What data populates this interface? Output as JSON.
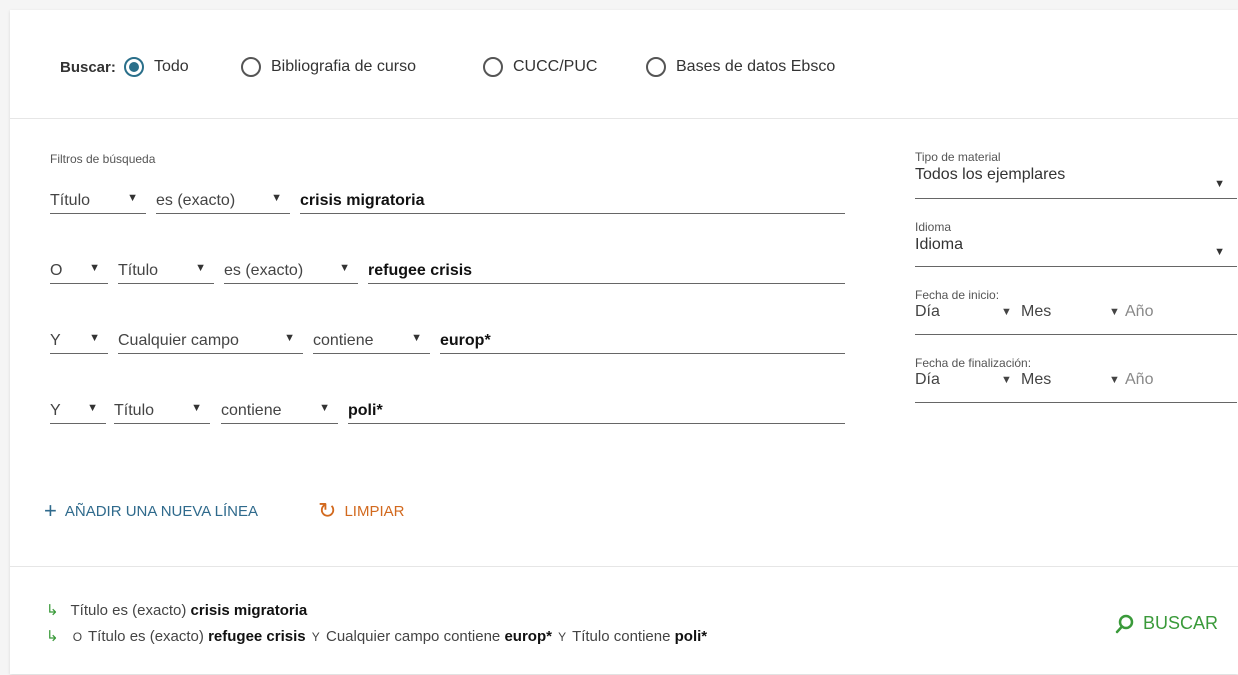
{
  "scope": {
    "label": "Buscar:",
    "options": [
      {
        "label": "Todo",
        "checked": true
      },
      {
        "label": "Bibliografia de curso",
        "checked": false
      },
      {
        "label": "CUCC/PUC",
        "checked": false
      },
      {
        "label": "Bases de datos Ebsco",
        "checked": false
      }
    ]
  },
  "filters": {
    "title": "Filtros de búsqueda",
    "rows": [
      {
        "field": "Título",
        "operator": "es (exacto)",
        "value": "crisis migratoria"
      },
      {
        "boolean": "O",
        "field": "Título",
        "operator": "es (exacto)",
        "value": "refugee crisis"
      },
      {
        "boolean": "Y",
        "field": "Cualquier campo",
        "operator": "contiene",
        "value": "europ*"
      },
      {
        "boolean": "Y",
        "field": "Título",
        "operator": "contiene",
        "value": "poli*"
      }
    ]
  },
  "side": {
    "material": {
      "label": "Tipo de material",
      "value": "Todos los ejemplares"
    },
    "language": {
      "label": "Idioma",
      "value": "Idioma"
    },
    "start_date": {
      "label": "Fecha de inicio:",
      "day": "Día",
      "month": "Mes",
      "year": "Año"
    },
    "end_date": {
      "label": "Fecha de finalización:",
      "day": "Día",
      "month": "Mes",
      "year": "Año"
    }
  },
  "actions": {
    "add_line": "AÑADIR UNA NUEVA LÍNEA",
    "clear": "LIMPIAR"
  },
  "summary": {
    "line1": {
      "field": "Título",
      "operator": "es (exacto)",
      "value": "crisis migratoria"
    },
    "line2": [
      {
        "boolean": "O",
        "field": "Título",
        "operator": "es (exacto)",
        "value": "refugee crisis"
      },
      {
        "boolean": "Y",
        "field": "Cualquier campo",
        "operator": "contiene",
        "value": "europ*"
      },
      {
        "boolean": "Y",
        "field": "Título",
        "operator": "contiene",
        "value": "poli*"
      }
    ]
  },
  "search_button": "BUSCAR",
  "colors": {
    "accent_teal": "#2a6f8a",
    "link_blue": "#2f6a8c",
    "clear_orange": "#d2691e",
    "search_green": "#3a9a3a"
  },
  "icons": {
    "add": "plus-icon",
    "clear": "reset-icon",
    "search": "search-icon",
    "arrow": "return-arrow-icon"
  }
}
